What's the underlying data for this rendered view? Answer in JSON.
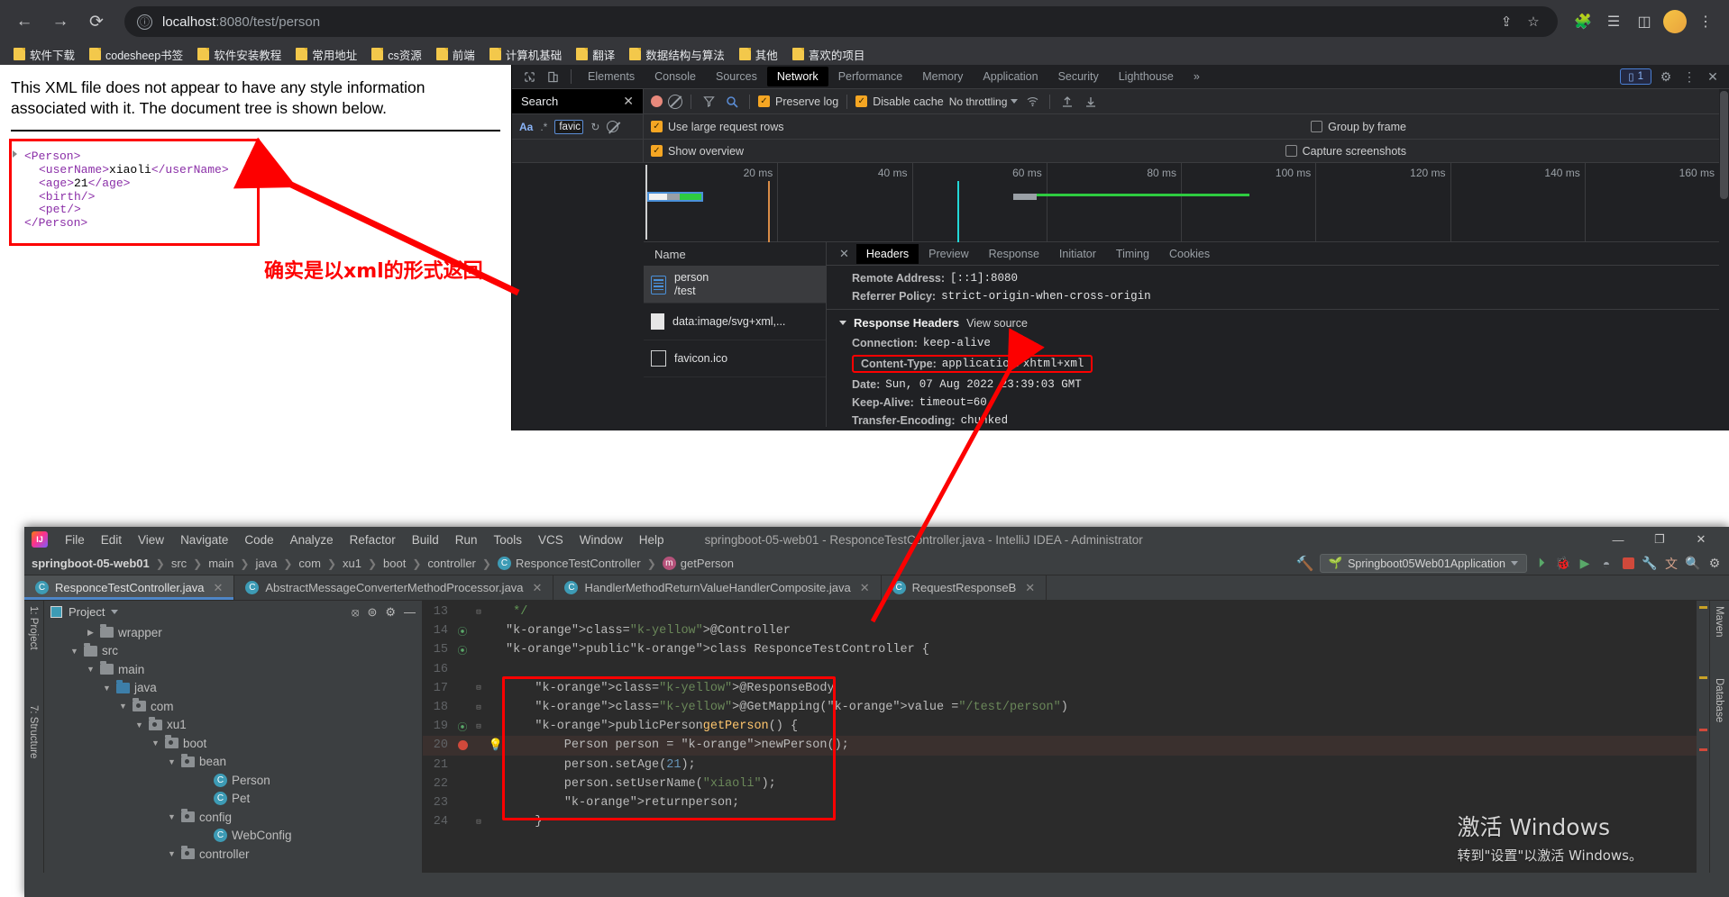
{
  "browser": {
    "nav": {
      "back_icon": "arrow-left-icon",
      "forward_icon": "arrow-right-icon",
      "reload_icon": "reload-icon",
      "back": "←",
      "forward": "→",
      "reload": "⟳"
    },
    "omnibox": {
      "info_icon": "ⓘ",
      "host": "localhost",
      "path": ":8080/test/person",
      "full_url": "localhost:8080/test/person",
      "share_icon": "⇪",
      "star_icon": "☆"
    },
    "toolbar_icons": {
      "extensions": "🧩",
      "reading_list": "☰",
      "side_panel": "◫",
      "profile": "●",
      "menu": "⋮"
    },
    "bookmarks": [
      {
        "label": "软件下载"
      },
      {
        "label": "codesheep书签"
      },
      {
        "label": "软件安装教程"
      },
      {
        "label": "常用地址"
      },
      {
        "label": "cs资源"
      },
      {
        "label": "前端"
      },
      {
        "label": "计算机基础"
      },
      {
        "label": "翻译"
      },
      {
        "label": "数据结构与算法"
      },
      {
        "label": "其他"
      },
      {
        "label": "喜欢的项目"
      }
    ]
  },
  "page": {
    "notice": "This XML file does not appear to have any style information associated with it. The document tree is shown below.",
    "xml": {
      "line1": "<Person>",
      "line2_open": "<userName>",
      "line2_text": "xiaoli",
      "line2_close": "</userName>",
      "line3_open": "<age>",
      "line3_text": "21",
      "line3_close": "</age>",
      "line4": "<birth/>",
      "line5": "<pet/>",
      "line6": "</Person>"
    },
    "annotation": "确实是以xml的形式返回"
  },
  "devtools": {
    "tabs": [
      {
        "label": "Elements",
        "active": false
      },
      {
        "label": "Console",
        "active": false
      },
      {
        "label": "Sources",
        "active": false
      },
      {
        "label": "Network",
        "active": true
      },
      {
        "label": "Performance",
        "active": false
      },
      {
        "label": "Memory",
        "active": false
      },
      {
        "label": "Application",
        "active": false
      },
      {
        "label": "Security",
        "active": false
      },
      {
        "label": "Lighthouse",
        "active": false
      }
    ],
    "overflow": "»",
    "message_badge": "1",
    "settings_icon": "gear-icon",
    "more_icon": "kebab-icon",
    "close_icon": "close-icon",
    "inspect_icon": "inspect-icon",
    "device_icon": "device-toolbar-icon",
    "search_panel": {
      "title": "Search",
      "close": "✕",
      "match_case": "Aa",
      "regex": ".*",
      "query": "favic",
      "refresh_icon": "refresh-icon",
      "clear_icon": "clear-icon"
    },
    "network_toolbar": {
      "record_icon": "record-button",
      "clear_icon": "clear-icon",
      "filter_icon": "filter-icon",
      "search_icon": "search-icon",
      "preserve_log": "Preserve log",
      "preserve_log_checked": true,
      "disable_cache": "Disable cache",
      "disable_cache_checked": true,
      "throttling": "No throttling",
      "wifi_icon": "wifi-icon",
      "import_icon": "upload-icon",
      "export_icon": "download-icon",
      "use_large_rows": "Use large request rows",
      "use_large_rows_checked": true,
      "group_by_frame": "Group by frame",
      "group_by_frame_checked": false,
      "show_overview": "Show overview",
      "show_overview_checked": true,
      "capture_screenshots": "Capture screenshots",
      "capture_screenshots_checked": false
    },
    "timeline": {
      "ticks": [
        "20 ms",
        "40 ms",
        "60 ms",
        "80 ms",
        "100 ms",
        "120 ms",
        "140 ms",
        "160 ms"
      ]
    },
    "request_list": {
      "column_header": "Name",
      "items": [
        {
          "name": "person",
          "sub": "/test",
          "icon": "document-icon",
          "selected": true
        },
        {
          "name": "data:image/svg+xml,...",
          "sub": "",
          "icon": "image-icon",
          "selected": false
        },
        {
          "name": "favicon.ico",
          "sub": "",
          "icon": "file-icon",
          "selected": false
        }
      ]
    },
    "detail_tabs": [
      {
        "label": "Headers",
        "active": true
      },
      {
        "label": "Preview",
        "active": false
      },
      {
        "label": "Response",
        "active": false
      },
      {
        "label": "Initiator",
        "active": false
      },
      {
        "label": "Timing",
        "active": false
      },
      {
        "label": "Cookies",
        "active": false
      }
    ],
    "detail_close": "✕",
    "headers": {
      "general": [
        {
          "key": "Remote Address:",
          "value": "[::1]:8080"
        },
        {
          "key": "Referrer Policy:",
          "value": "strict-origin-when-cross-origin"
        }
      ],
      "response_section_title": "Response Headers",
      "view_source": "View source",
      "response": [
        {
          "key": "Connection:",
          "value": "keep-alive",
          "highlight": false
        },
        {
          "key": "Content-Type:",
          "value": "application/xhtml+xml",
          "highlight": true
        },
        {
          "key": "Date:",
          "value": "Sun, 07 Aug 2022 23:39:03 GMT",
          "highlight": false
        },
        {
          "key": "Keep-Alive:",
          "value": "timeout=60",
          "highlight": false
        },
        {
          "key": "Transfer-Encoding:",
          "value": "chunked",
          "highlight": false
        }
      ]
    }
  },
  "ide": {
    "title": "springboot-05-web01 - ResponceTestController.java - IntelliJ IDEA - Administrator",
    "logo_text": "IJ",
    "menus": [
      "File",
      "Edit",
      "View",
      "Navigate",
      "Code",
      "Analyze",
      "Refactor",
      "Build",
      "Run",
      "Tools",
      "VCS",
      "Window",
      "Help"
    ],
    "window_buttons": {
      "minimize": "—",
      "maximize": "❐",
      "close": "✕"
    },
    "breadcrumbs": [
      {
        "label": "springboot-05-web01",
        "bold": true,
        "badge": ""
      },
      {
        "label": "src",
        "bold": false,
        "badge": ""
      },
      {
        "label": "main",
        "bold": false,
        "badge": ""
      },
      {
        "label": "java",
        "bold": false,
        "badge": ""
      },
      {
        "label": "com",
        "bold": false,
        "badge": ""
      },
      {
        "label": "xu1",
        "bold": false,
        "badge": ""
      },
      {
        "label": "boot",
        "bold": false,
        "badge": ""
      },
      {
        "label": "controller",
        "bold": false,
        "badge": ""
      },
      {
        "label": "ResponceTestController",
        "bold": false,
        "badge": "C"
      },
      {
        "label": "getPerson",
        "bold": false,
        "badge": "m"
      }
    ],
    "run_config": "Springboot05Web01Application",
    "toolbar_icons": [
      "run-icon",
      "debug-icon",
      "coverage-icon",
      "profile-icon",
      "stop-icon",
      "build-icon",
      "translate-icon",
      "search-everywhere-icon",
      "settings-icon"
    ],
    "editor_tabs": [
      {
        "label": "ResponceTestController.java",
        "active": true,
        "badge": "C"
      },
      {
        "label": "AbstractMessageConverterMethodProcessor.java",
        "active": false,
        "badge": "C"
      },
      {
        "label": "HandlerMethodReturnValueHandlerComposite.java",
        "active": false,
        "badge": "C"
      },
      {
        "label": "RequestResponseB",
        "active": false,
        "badge": "C"
      }
    ],
    "left_strips": [
      "1: Project",
      "7: Structure"
    ],
    "right_strips": [
      "Maven",
      "Database"
    ],
    "project_panel": {
      "title": "Project",
      "caret": "▾",
      "icons": [
        "locate-icon",
        "collapse-icon",
        "gear-icon",
        "minimize-icon"
      ],
      "tree": [
        {
          "label": "wrapper",
          "depth": 2,
          "arrow": "▶",
          "type": "folder"
        },
        {
          "label": "src",
          "depth": 1,
          "arrow": "▼",
          "type": "folder"
        },
        {
          "label": "main",
          "depth": 2,
          "arrow": "▼",
          "type": "folder"
        },
        {
          "label": "java",
          "depth": 3,
          "arrow": "▼",
          "type": "folder-blue"
        },
        {
          "label": "com",
          "depth": 4,
          "arrow": "▼",
          "type": "package"
        },
        {
          "label": "xu1",
          "depth": 5,
          "arrow": "▼",
          "type": "package"
        },
        {
          "label": "boot",
          "depth": 6,
          "arrow": "▼",
          "type": "package"
        },
        {
          "label": "bean",
          "depth": 7,
          "arrow": "▼",
          "type": "package"
        },
        {
          "label": "Person",
          "depth": 9,
          "arrow": "",
          "type": "class"
        },
        {
          "label": "Pet",
          "depth": 9,
          "arrow": "",
          "type": "class"
        },
        {
          "label": "config",
          "depth": 7,
          "arrow": "▼",
          "type": "package"
        },
        {
          "label": "WebConfig",
          "depth": 9,
          "arrow": "",
          "type": "class"
        },
        {
          "label": "controller",
          "depth": 7,
          "arrow": "▼",
          "type": "package"
        }
      ]
    },
    "code": {
      "lines": [
        {
          "num": "13",
          "indent": 1,
          "fold": "⊟",
          "gicon": "",
          "text": "*/",
          "cls": "k-comment",
          "hl": false
        },
        {
          "num": "14",
          "indent": 0,
          "fold": "",
          "gicon": "bean-icon",
          "text": "@Controller",
          "cls": "k-yellow",
          "hl": false
        },
        {
          "num": "15",
          "indent": 0,
          "fold": "",
          "gicon": "bean-icon",
          "text": "public class ResponceTestController {",
          "cls": "",
          "hl": false
        },
        {
          "num": "16",
          "indent": 0,
          "fold": "",
          "gicon": "",
          "text": "",
          "cls": "",
          "hl": false
        },
        {
          "num": "17",
          "indent": 0,
          "fold": "⊟",
          "gicon": "",
          "text": "@ResponseBody",
          "cls": "k-yellow",
          "hl": false
        },
        {
          "num": "18",
          "indent": 0,
          "fold": "⊟",
          "gicon": "",
          "text": "@GetMapping(value = \"/test/person\")",
          "cls": "",
          "hl": false
        },
        {
          "num": "19",
          "indent": 0,
          "fold": "⊟",
          "gicon": "bean-icon",
          "text": "public Person getPerson() {",
          "cls": "",
          "hl": false
        },
        {
          "num": "20",
          "indent": 0,
          "fold": "",
          "gicon": "breakpoint",
          "text": "Person person = new Person();",
          "cls": "",
          "hl": true
        },
        {
          "num": "21",
          "indent": 0,
          "fold": "",
          "gicon": "",
          "text": "person.setAge(21);",
          "cls": "",
          "hl": false
        },
        {
          "num": "22",
          "indent": 0,
          "fold": "",
          "gicon": "",
          "text": "person.setUserName(\"xiaoli\");",
          "cls": "",
          "hl": false
        },
        {
          "num": "23",
          "indent": 0,
          "fold": "",
          "gicon": "",
          "text": "return person;",
          "cls": "",
          "hl": false
        },
        {
          "num": "24",
          "indent": 0,
          "fold": "⊟",
          "gicon": "",
          "text": "}",
          "cls": "",
          "hl": false
        }
      ]
    }
  },
  "watermark": {
    "line1": "激活 Windows",
    "line2": "转到\"设置\"以激活 Windows。"
  },
  "colors": {
    "accent_red": "#fd0000",
    "chrome_bg": "#35363a",
    "devtools_bg": "#202124",
    "ide_bg": "#3c3f41",
    "editor_bg": "#2b2b2b",
    "check_orange": "#f5a623"
  }
}
